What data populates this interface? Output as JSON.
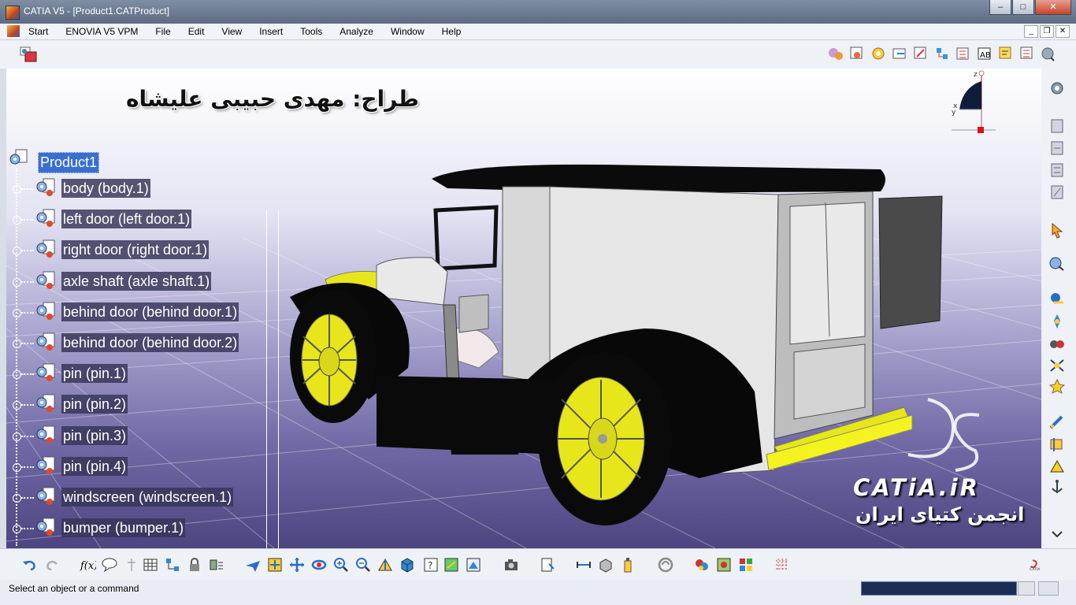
{
  "window": {
    "title": "CATIA V5 - [Product1.CATProduct]",
    "buttons": {
      "minimize": "–",
      "maximize": "□",
      "close": "✕"
    }
  },
  "menu": {
    "items": [
      "Start",
      "ENOVIA V5 VPM",
      "File",
      "Edit",
      "View",
      "Insert",
      "Tools",
      "Analyze",
      "Window",
      "Help"
    ]
  },
  "overlay": {
    "designer": "طراح: مهدی حبیبی علیشاه",
    "brand": "CATiA.iR",
    "brand_fa": "انجمن کتیای ایران"
  },
  "tree": {
    "root": "Product1",
    "items": [
      "body (body.1)",
      "left door (left door.1)",
      "right door (right door.1)",
      "axle shaft (axle shaft.1)",
      "behind door (behind door.1)",
      "behind door (behind door.2)",
      "pin (pin.1)",
      "pin (pin.2)",
      "pin (pin.3)",
      "pin (pin.4)",
      "windscreen (windscreen.1)",
      "bumper (bumper.1)"
    ]
  },
  "compass": {
    "z": "z",
    "x": "x",
    "y": "y"
  },
  "status": {
    "message": "Select an object or a command"
  },
  "colors": {
    "selection": "#3a6fd0",
    "car_body": "#e6e6e6",
    "wheel": "#e7e61a",
    "roof": "#0a0a0a"
  }
}
